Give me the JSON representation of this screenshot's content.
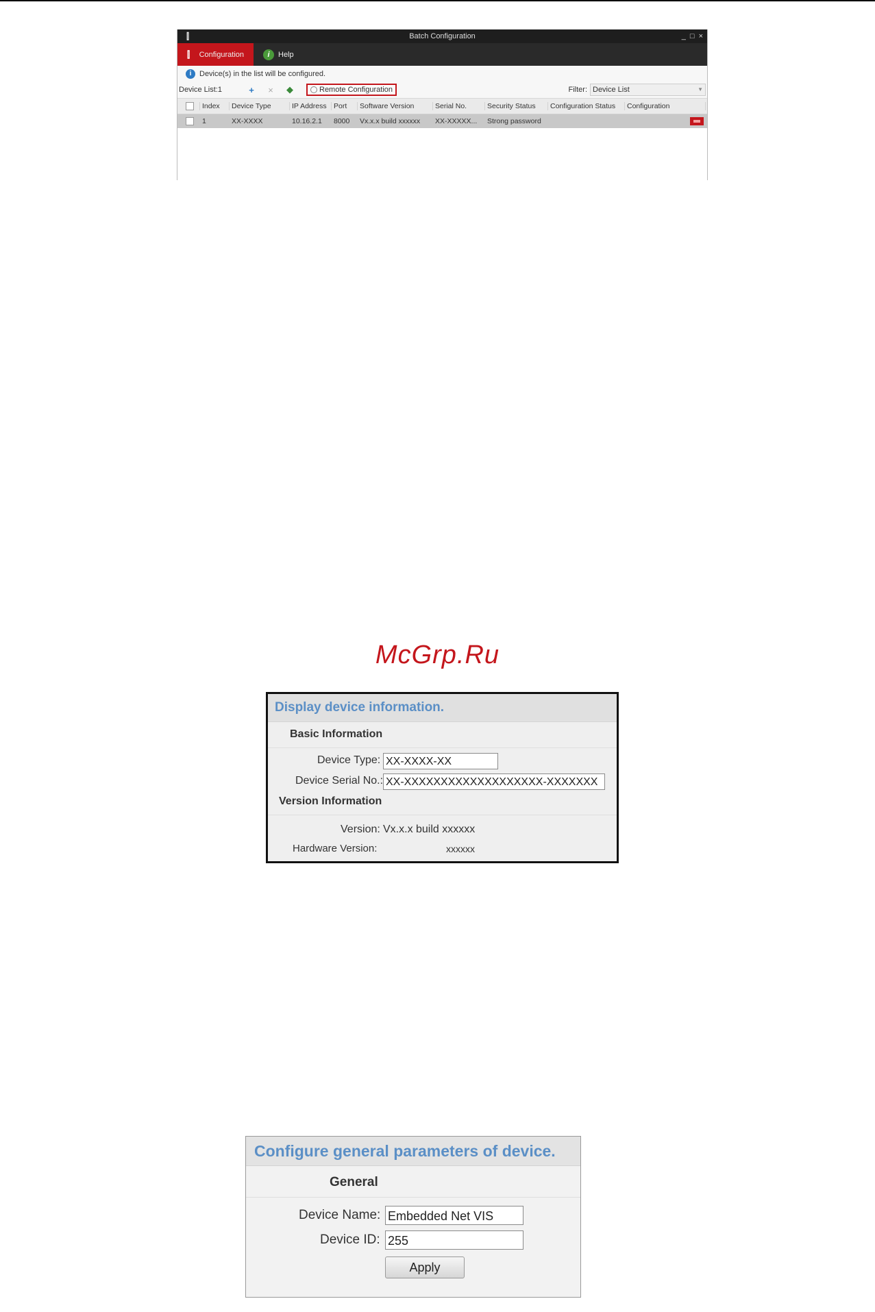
{
  "window": {
    "title": "Batch Configuration",
    "controls": [
      "_",
      "□",
      "×"
    ],
    "tabs": [
      {
        "label": "Configuration",
        "icon": "configuration-icon"
      },
      {
        "label": "Help",
        "icon": "help-icon"
      }
    ],
    "info_text": "Device(s) in the list will be configured.",
    "device_list_label": "Device List:1",
    "toolbar_icons": [
      "add-icon",
      "delete-icon",
      "refresh-icon"
    ],
    "toolbar_glyphs": {
      "add": "+",
      "delete": "×",
      "refresh": "◆"
    },
    "remote_config_label": "Remote Configuration",
    "filter_label": "Filter:",
    "filter_value": "Device List",
    "columns": [
      "Index",
      "Device Type",
      "IP Address",
      "Port",
      "Software Version",
      "Serial No.",
      "Security Status",
      "Configuration Status",
      "Configuration"
    ],
    "rows": [
      {
        "index": "1",
        "device_type": "XX-XXXX",
        "ip": "10.16.2.1",
        "port": "8000",
        "software_version": "Vx.x.x build xxxxxx",
        "serial": "XX-XXXXX...",
        "security_status": "Strong password",
        "config_status": ""
      }
    ]
  },
  "watermark": "McGrp.Ru",
  "device_info": {
    "title": "Display device information.",
    "basic_section": "Basic Information",
    "device_type_label": "Device Type:",
    "device_type_value": "XX-XXXX-XX",
    "serial_label": "Device Serial No.:",
    "serial_value": "XX-XXXXXXXXXXXXXXXXXXX-XXXXXXX",
    "version_section": "Version Information",
    "version_label": "Version:",
    "version_value": "Vx.x.x build xxxxxx",
    "hw_version_label": "Hardware Version:",
    "hw_version_value": "xxxxxx"
  },
  "general": {
    "title": "Configure general parameters of device.",
    "section": "General",
    "name_label": "Device Name:",
    "name_value": "Embedded Net VIS",
    "id_label": "Device ID:",
    "id_value": "255",
    "apply_label": "Apply"
  },
  "colors": {
    "accent_red": "#c4161c",
    "panel_title_blue": "#5b8fc6",
    "title_bar": "#1e1e1e"
  }
}
